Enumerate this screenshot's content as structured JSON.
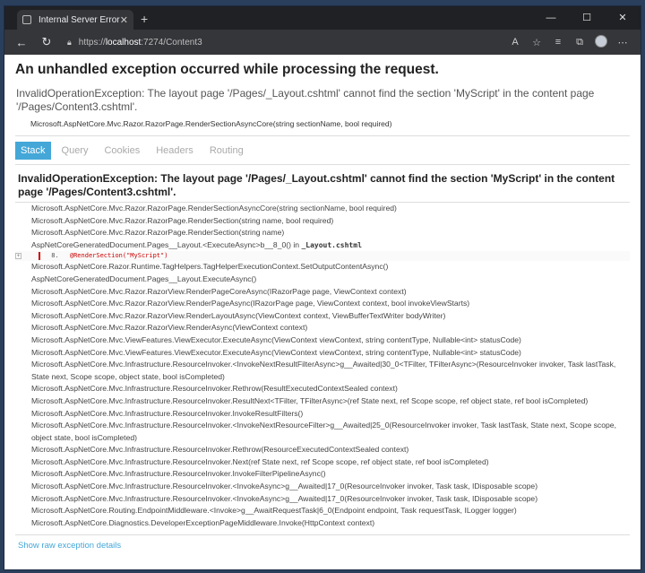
{
  "browser": {
    "tab_title": "Internal Server Error",
    "tab_close": "✕",
    "new_tab": "+",
    "window_controls": [
      "—",
      "☐",
      "✕"
    ],
    "url_prefix": "https://",
    "url_host": "localhost",
    "url_rest": ":7274/Content3",
    "icons": {
      "back": "arrow-left-icon",
      "refresh": "refresh-icon",
      "lock": "lock-icon",
      "read_aloud": "read-aloud-icon",
      "favorite": "star-icon",
      "collections": "collections-icon",
      "favorites_bar": "favorites-icon",
      "more": "more-icon"
    }
  },
  "page": {
    "title": "An unhandled exception occurred while processing the request.",
    "subtitle": "InvalidOperationException: The layout page '/Pages/_Layout.cshtml' cannot find the section 'MyScript' in the content page '/Pages/Content3.cshtml'.",
    "location": "Microsoft.AspNetCore.Mvc.Razor.RazorPage.RenderSectionAsyncCore(string sectionName, bool required)",
    "tabs": [
      "Stack",
      "Query",
      "Cookies",
      "Headers",
      "Routing"
    ],
    "active_tab": "Stack",
    "exception_title": "InvalidOperationException: The layout page '/Pages/_Layout.cshtml' cannot find the section 'MyScript' in the content page '/Pages/Content3.cshtml'.",
    "frames_before": [
      "Microsoft.AspNetCore.Mvc.Razor.RazorPage.RenderSectionAsyncCore(string sectionName, bool required)",
      "Microsoft.AspNetCore.Mvc.Razor.RazorPage.RenderSection(string name, bool required)",
      "Microsoft.AspNetCore.Mvc.Razor.RazorPage.RenderSection(string name)"
    ],
    "frame_with_file": {
      "method": "AspNetCoreGeneratedDocument.Pages__Layout.<ExecuteAsync>b__8_0() in ",
      "file": "_Layout.cshtml"
    },
    "source_line": {
      "expander": "+",
      "number": "8.",
      "code": "@RenderSection(\"MyScript\")"
    },
    "frames_after": [
      "Microsoft.AspNetCore.Razor.Runtime.TagHelpers.TagHelperExecutionContext.SetOutputContentAsync()",
      "AspNetCoreGeneratedDocument.Pages__Layout.ExecuteAsync()",
      "Microsoft.AspNetCore.Mvc.Razor.RazorView.RenderPageCoreAsync(IRazorPage page, ViewContext context)",
      "Microsoft.AspNetCore.Mvc.Razor.RazorView.RenderPageAsync(IRazorPage page, ViewContext context, bool invokeViewStarts)",
      "Microsoft.AspNetCore.Mvc.Razor.RazorView.RenderLayoutAsync(ViewContext context, ViewBufferTextWriter bodyWriter)",
      "Microsoft.AspNetCore.Mvc.Razor.RazorView.RenderAsync(ViewContext context)",
      "Microsoft.AspNetCore.Mvc.ViewFeatures.ViewExecutor.ExecuteAsync(ViewContext viewContext, string contentType, Nullable<int> statusCode)",
      "Microsoft.AspNetCore.Mvc.ViewFeatures.ViewExecutor.ExecuteAsync(ViewContext viewContext, string contentType, Nullable<int> statusCode)",
      "Microsoft.AspNetCore.Mvc.Infrastructure.ResourceInvoker.<InvokeNextResultFilterAsync>g__Awaited|30_0<TFilter, TFilterAsync>(ResourceInvoker invoker, Task lastTask, State next, Scope scope, object state, bool isCompleted)",
      "Microsoft.AspNetCore.Mvc.Infrastructure.ResourceInvoker.Rethrow(ResultExecutedContextSealed context)",
      "Microsoft.AspNetCore.Mvc.Infrastructure.ResourceInvoker.ResultNext<TFilter, TFilterAsync>(ref State next, ref Scope scope, ref object state, ref bool isCompleted)",
      "Microsoft.AspNetCore.Mvc.Infrastructure.ResourceInvoker.InvokeResultFilters()",
      "Microsoft.AspNetCore.Mvc.Infrastructure.ResourceInvoker.<InvokeNextResourceFilter>g__Awaited|25_0(ResourceInvoker invoker, Task lastTask, State next, Scope scope, object state, bool isCompleted)",
      "Microsoft.AspNetCore.Mvc.Infrastructure.ResourceInvoker.Rethrow(ResourceExecutedContextSealed context)",
      "Microsoft.AspNetCore.Mvc.Infrastructure.ResourceInvoker.Next(ref State next, ref Scope scope, ref object state, ref bool isCompleted)",
      "Microsoft.AspNetCore.Mvc.Infrastructure.ResourceInvoker.InvokeFilterPipelineAsync()",
      "Microsoft.AspNetCore.Mvc.Infrastructure.ResourceInvoker.<InvokeAsync>g__Awaited|17_0(ResourceInvoker invoker, Task task, IDisposable scope)",
      "Microsoft.AspNetCore.Mvc.Infrastructure.ResourceInvoker.<InvokeAsync>g__Awaited|17_0(ResourceInvoker invoker, Task task, IDisposable scope)",
      "Microsoft.AspNetCore.Routing.EndpointMiddleware.<Invoke>g__AwaitRequestTask|6_0(Endpoint endpoint, Task requestTask, ILogger logger)",
      "Microsoft.AspNetCore.Diagnostics.DeveloperExceptionPageMiddleware.Invoke(HttpContext context)"
    ],
    "raw_link": "Show raw exception details"
  }
}
